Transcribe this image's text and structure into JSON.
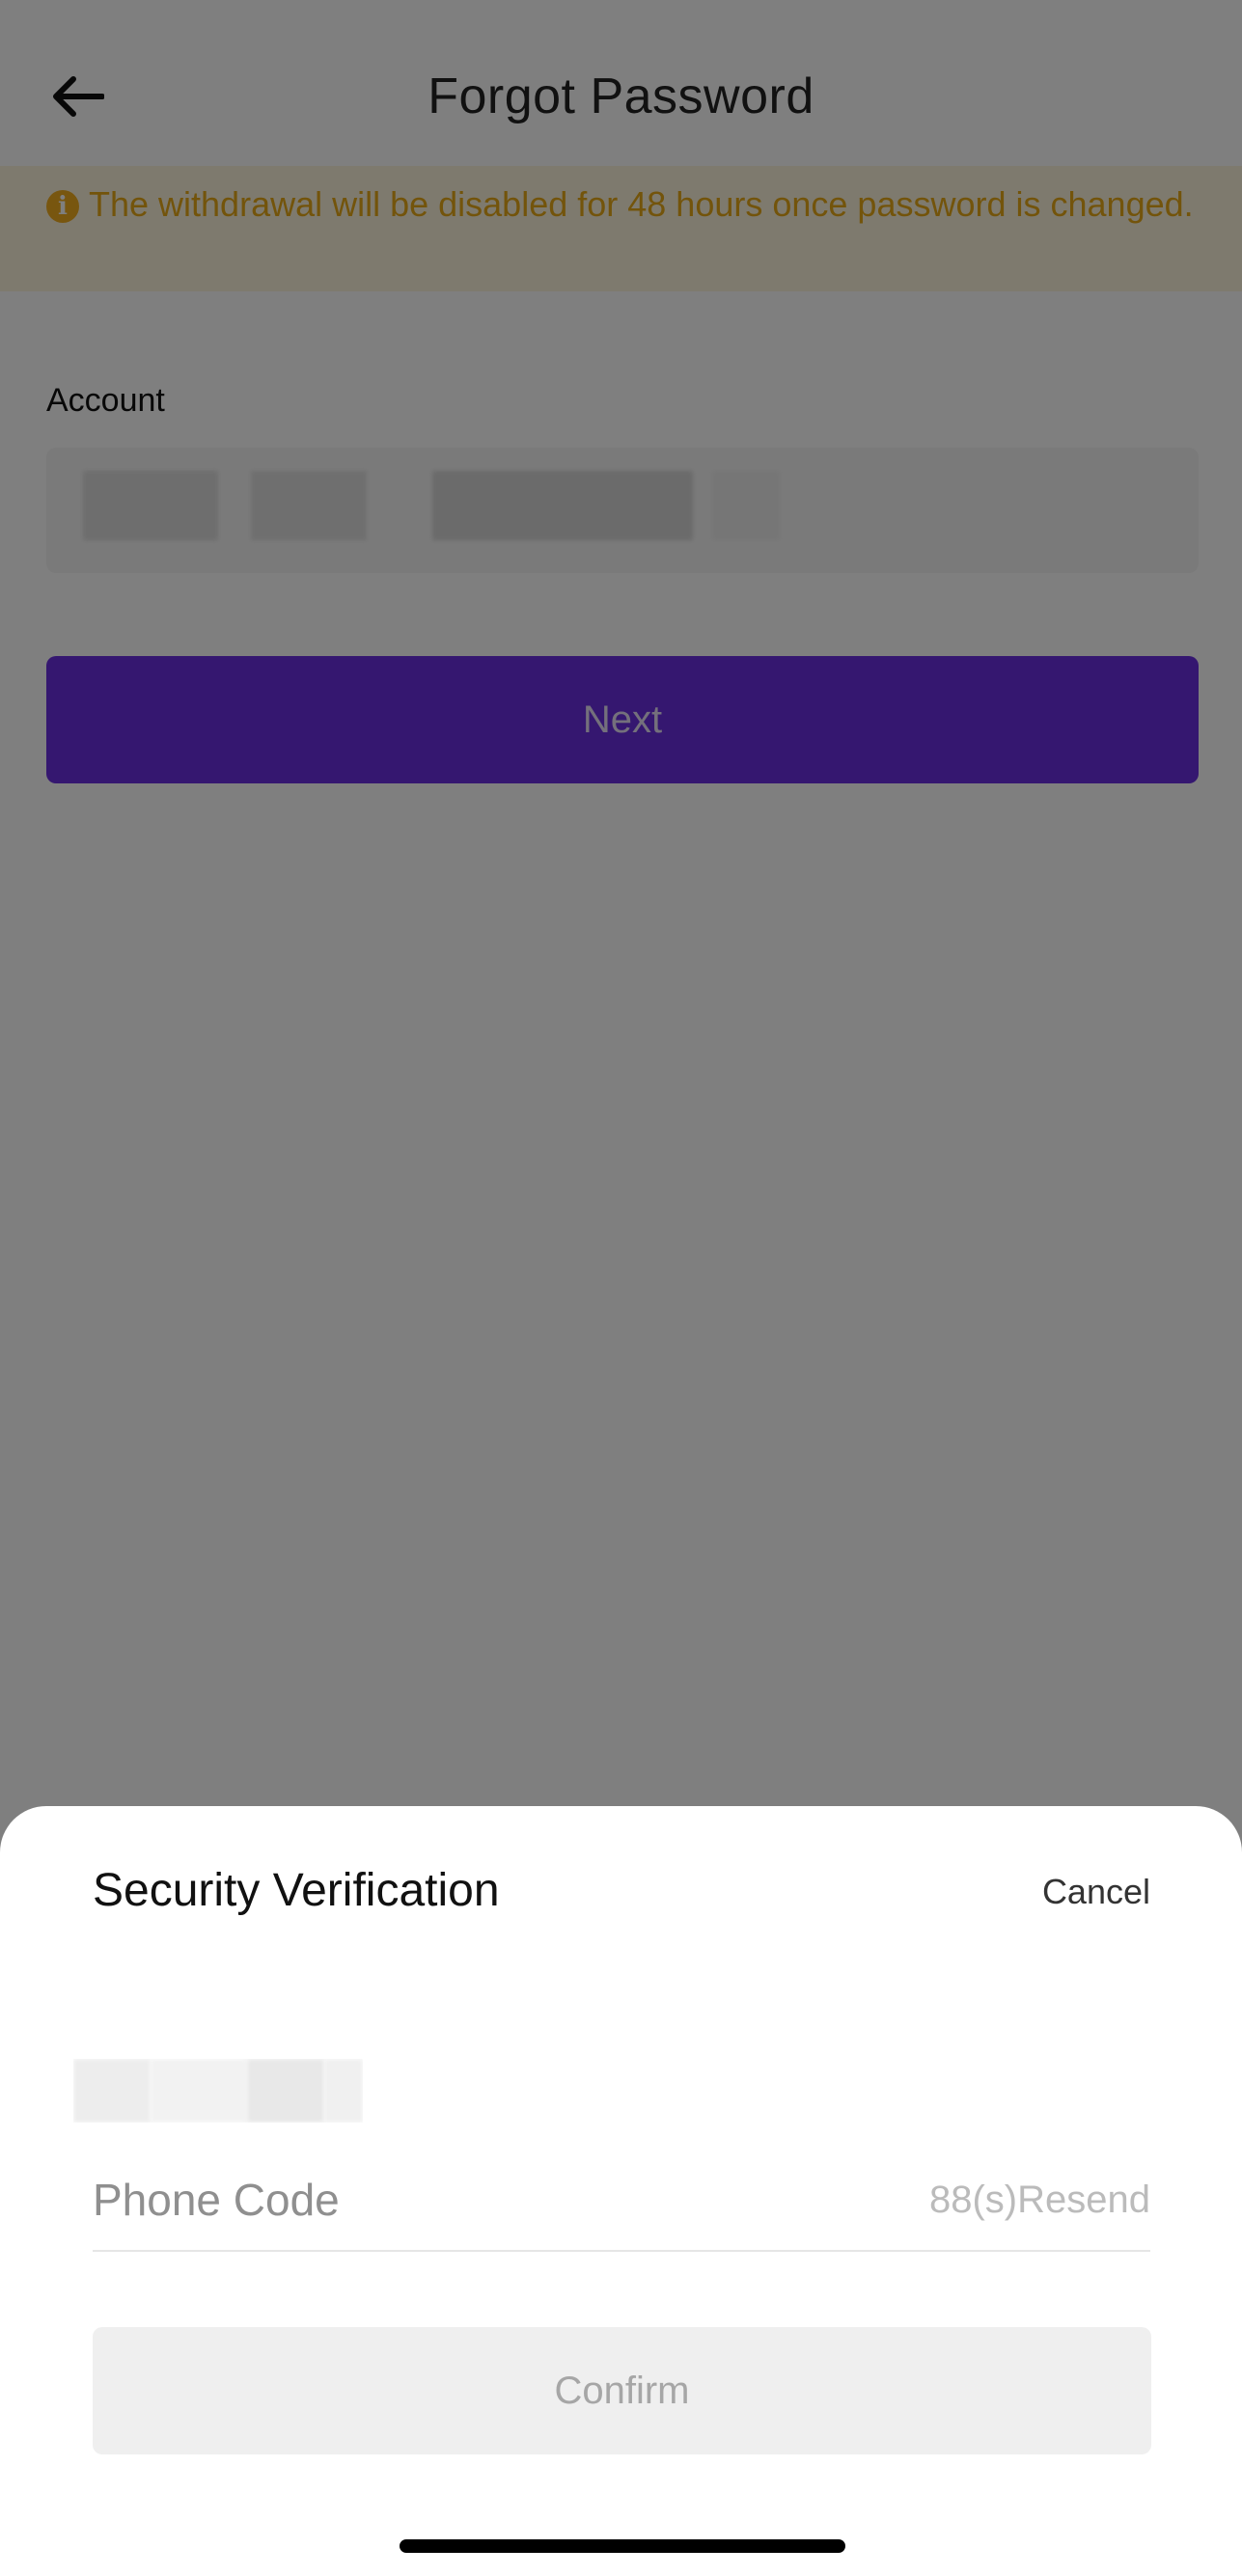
{
  "header": {
    "title": "Forgot Password",
    "back_icon": "arrow-left-icon"
  },
  "banner": {
    "icon": "info-icon",
    "icon_glyph": "i",
    "text": "The withdrawal will be disabled for 48 hours once password is changed.",
    "color": "#e6a817"
  },
  "account": {
    "label": "Account"
  },
  "next_button": {
    "label": "Next",
    "color": "#6a2ee0"
  },
  "security_sheet": {
    "title": "Security Verification",
    "cancel_label": "Cancel",
    "phone_code_placeholder": "Phone Code",
    "resend_label": "88(s)Resend",
    "confirm_label": "Confirm"
  }
}
